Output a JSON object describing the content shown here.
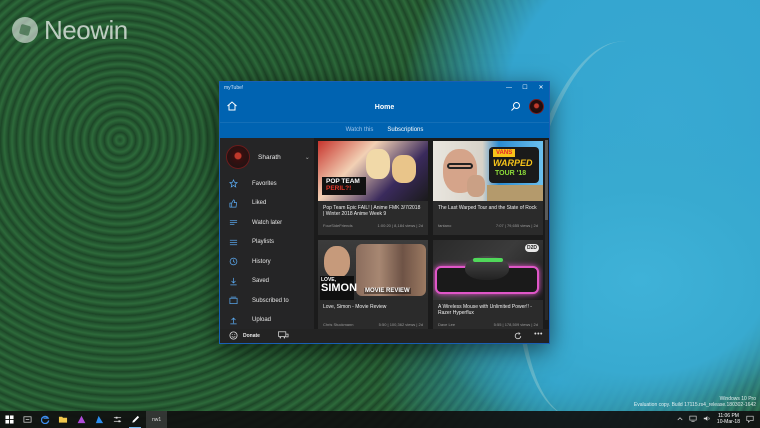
{
  "desktop": {
    "watermark": "Neowin",
    "eval_line1": "Windows 10 Pro",
    "eval_line2": "Evaluation copy. Build 17115.rs4_release.180302-1642"
  },
  "window": {
    "title": "myTube!",
    "controls": {
      "minimize": "—",
      "maximize": "☐",
      "close": "✕"
    }
  },
  "appbar": {
    "title": "Home"
  },
  "tabs": [
    {
      "label": "Watch this",
      "active": false
    },
    {
      "label": "Subscriptions",
      "active": true
    }
  ],
  "profile": {
    "name": "Sharath",
    "chevron": "⌄"
  },
  "sidebar": {
    "items": [
      {
        "label": "Favorites",
        "icon": "star-icon"
      },
      {
        "label": "Liked",
        "icon": "thumbs-up-icon"
      },
      {
        "label": "Watch later",
        "icon": "watch-later-icon"
      },
      {
        "label": "Playlists",
        "icon": "playlist-icon"
      },
      {
        "label": "History",
        "icon": "history-icon"
      },
      {
        "label": "Saved",
        "icon": "download-icon"
      },
      {
        "label": "Subscribed to",
        "icon": "subscriptions-icon"
      },
      {
        "label": "Upload",
        "icon": "upload-icon"
      }
    ]
  },
  "videos": [
    {
      "title": "Pop Team Epic FAIL! | Anime FMK 3/7/2018 | Winter 2018 Anime Week 9",
      "channel": "FourSideFriends",
      "stats": "1:00:20 | 8,184 views | 2d",
      "thumb_text_1": "POP TEAM",
      "thumb_text_2": "PERIL?!"
    },
    {
      "title": "The Last Warped Tour and the State of Rock",
      "channel": "fantano",
      "stats": "7:07 | 79,655 views | 2d",
      "thumb_text_1": "VANS",
      "thumb_text_2": "WARPED",
      "thumb_text_3": "TOUR '18"
    },
    {
      "title": "Love, Simon - Movie Review",
      "channel": "Chris Stuckmann",
      "stats": "5:50 | 100,362 views | 2d",
      "thumb_text_1": "LOVE,",
      "thumb_text_2": "SIMON",
      "thumb_text_3": "MOVIE REVIEW"
    },
    {
      "title": "A Wireless Mouse with Unlimited Power!! - Razer Hyperflux",
      "channel": "Dave Lee",
      "stats": "5:55 | 178,509 views | 2d",
      "thumb_text_1": "D2D"
    }
  ],
  "bottombar": {
    "donate_label": "Donate",
    "more": "•••"
  },
  "taskbar": {
    "app_label": "nw1",
    "time": "11:06 PM",
    "date": "10-Mar-18"
  },
  "colors": {
    "accent": "#0063b1",
    "sidebar": "#252526",
    "grid_bg": "#1b1b1b",
    "card": "#2b2b2b"
  }
}
